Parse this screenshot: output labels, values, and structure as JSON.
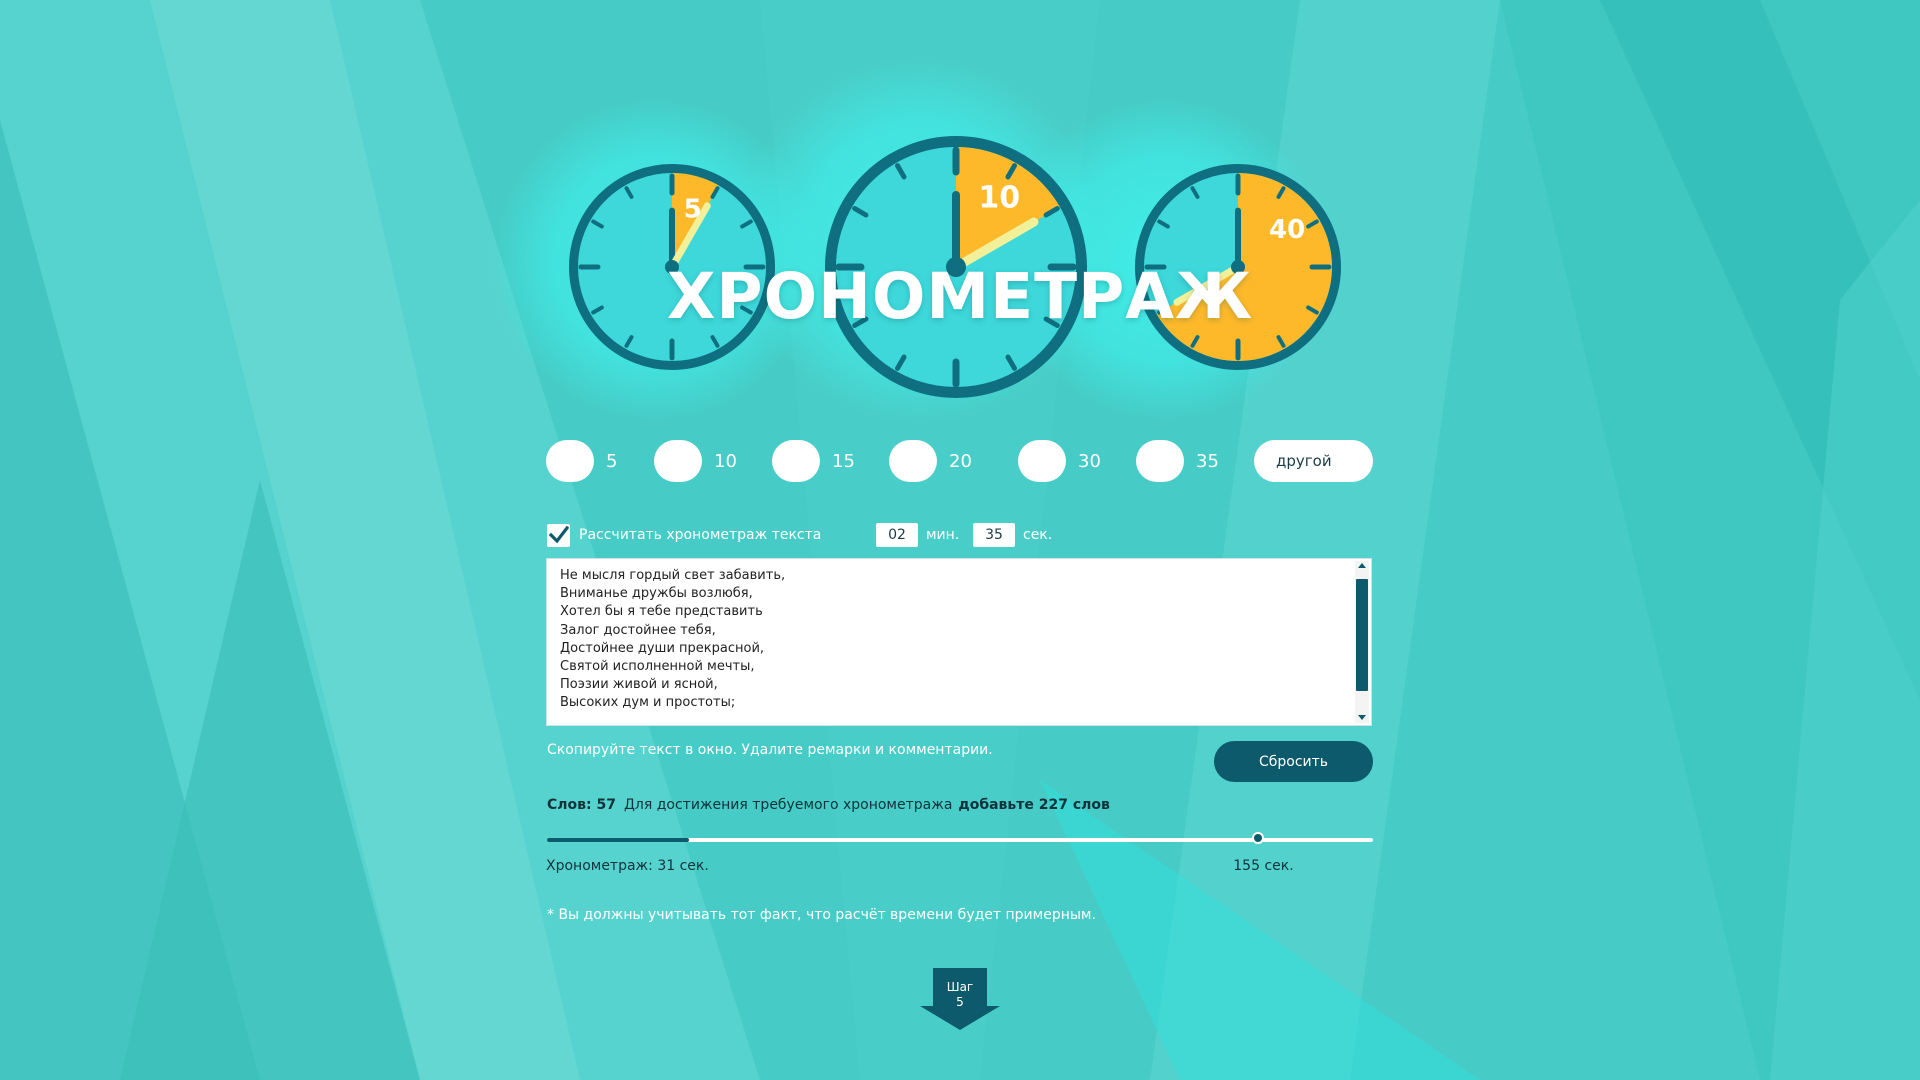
{
  "header": {
    "title": "ХРОНОМЕТРАЖ",
    "clocks": [
      {
        "label": "5",
        "fraction": 0.0833
      },
      {
        "label": "10",
        "fraction": 0.1667
      },
      {
        "label": "40",
        "fraction": 0.6667
      }
    ]
  },
  "options": [
    {
      "label": "5"
    },
    {
      "label": "10"
    },
    {
      "label": "15"
    },
    {
      "label": "20"
    },
    {
      "label": "30"
    },
    {
      "label": "35"
    }
  ],
  "other_button": "другой",
  "calc": {
    "checkbox_label": "Рассчитать хронометраж текста",
    "checked": true,
    "minutes": "02",
    "minutes_unit": "мин.",
    "seconds": "35",
    "seconds_unit": "сек."
  },
  "text_lines": [
    "Не мысля гордый свет забавить,",
    "Вниманье дружбы возлюбя,",
    "Хотел бы я тебе представить",
    "Залог достойнее тебя,",
    "Достойнее души прекрасной,",
    "Святой исполненной мечты,",
    "Поэзии живой и ясной,",
    "Высоких дум и простоты;"
  ],
  "hint": "Скопируйте текст в окно. Удалите ремарки и комментарии.",
  "reset_button": "Сбросить",
  "stats": {
    "words": "Слов: 57",
    "middle": "Для достижения требуемого хронометража",
    "add": "добавьте 227 слов"
  },
  "slider": {
    "current_seconds": 31,
    "target_seconds": 155,
    "max_seconds": 180,
    "current_label": "Хронометраж: 31 сек.",
    "target_label": "155 сек."
  },
  "note": "* Вы должны учитывать тот факт, что расчёт времени будет примерным.",
  "step": {
    "line1": "Шаг",
    "line2": "5"
  },
  "colors": {
    "accent": "#0c5a6c",
    "clock_face": "#3ed8da",
    "clock_rim": "#0f6f80",
    "clock_sector": "#fdb92a",
    "hand": "#f2f19a"
  }
}
